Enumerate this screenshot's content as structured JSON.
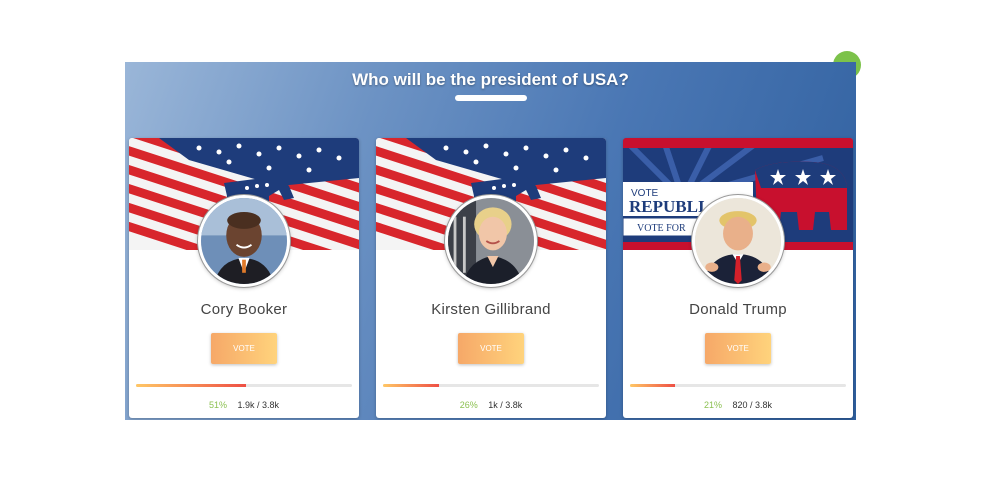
{
  "poll": {
    "title": "Who will be the president of USA?",
    "colors": {
      "accent_green": "#8cc152",
      "button_start": "#f6a868",
      "button_end": "#ffd37c"
    }
  },
  "candidates": [
    {
      "name": "Cory Booker",
      "vote_label": "VOTE",
      "percent_text": "51%",
      "votes_text": "1.9k / 3.8k",
      "share": 0.51,
      "banner_icon": "democrat-donkey-flag"
    },
    {
      "name": "Kirsten Gillibrand",
      "vote_label": "VOTE",
      "percent_text": "26%",
      "votes_text": "1k / 3.8k",
      "share": 0.26,
      "banner_icon": "democrat-donkey-flag"
    },
    {
      "name": "Donald Trump",
      "vote_label": "VOTE",
      "percent_text": "21%",
      "votes_text": "820 / 3.8k",
      "share": 0.21,
      "banner_icon": "republican-elephant-banner",
      "banner_text": {
        "line1": "VOTE",
        "line2": "REPUBLI",
        "line3": "VOTE FOR"
      }
    }
  ]
}
